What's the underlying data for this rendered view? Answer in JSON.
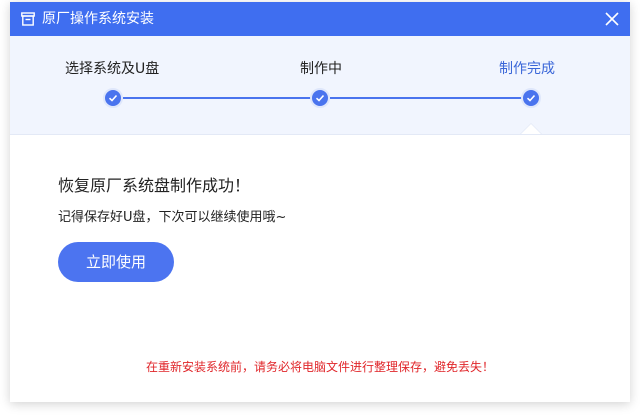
{
  "window": {
    "title": "原厂操作系统安装",
    "title_icon": "installer-icon",
    "close_icon": "close-icon"
  },
  "steps": [
    {
      "label": "选择系统及U盘",
      "status": "done"
    },
    {
      "label": "制作中",
      "status": "done"
    },
    {
      "label": "制作完成",
      "status": "done",
      "active": true
    }
  ],
  "result": {
    "title": "恢复原厂系统盘制作成功！",
    "subtitle": "记得保存好U盘，下次可以继续使用哦~",
    "button_label": "立即使用"
  },
  "warning": "在重新安装系统前，请务必将电脑文件进行整理保存，避免丢失！",
  "colors": {
    "titlebar": "#3f6ef0",
    "accent": "#4a74ee",
    "active_step": "#3a66d8",
    "warning": "#e0262a",
    "steps_bg": "#f1f5fe"
  }
}
